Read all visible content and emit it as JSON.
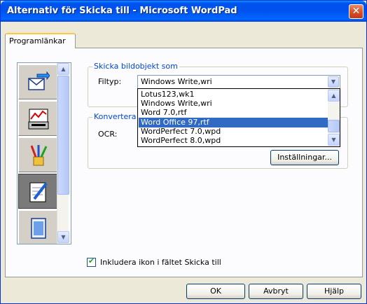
{
  "window": {
    "title": "Alternativ för Skicka till - Microsoft WordPad",
    "close_glyph": "✕"
  },
  "tabs": [
    {
      "label": "Programlänkar"
    }
  ],
  "icon_list": {
    "items": [
      {
        "icon": "envelope-arrow-icon",
        "selected": false
      },
      {
        "icon": "graph-printer-icon",
        "selected": false
      },
      {
        "icon": "paint-brushes-icon",
        "selected": false
      },
      {
        "icon": "notepad-pen-icon",
        "selected": true
      },
      {
        "icon": "document-icon",
        "selected": false
      }
    ],
    "scroll_up_glyph": "▲",
    "scroll_down_glyph": "▼"
  },
  "send_group": {
    "label": "Skicka bildobjekt som",
    "filetype_label": "Filtyp:",
    "selected_value": "Windows Write,wri",
    "dropdown_options": [
      {
        "label": "Lotus123,wk1",
        "selected": false
      },
      {
        "label": "Windows Write,wri",
        "selected": false
      },
      {
        "label": "Word 7.0,rtf",
        "selected": false
      },
      {
        "label": "Word Office 97,rtf",
        "selected": true
      },
      {
        "label": "WordPerfect 7.0,wpd",
        "selected": false
      },
      {
        "label": "WordPerfect 8.0,wpd",
        "selected": false
      }
    ]
  },
  "convert_group": {
    "label": "Konvertera b",
    "ocr_label": "OCR:",
    "settings_button": "Inställningar..."
  },
  "include_checkbox": {
    "label": "Inkludera ikon i fältet Skicka till",
    "checked": true,
    "check_glyph": "✔"
  },
  "buttons": {
    "ok": "OK",
    "cancel": "Avbryt",
    "help": "Hjälp"
  },
  "colors": {
    "titlebar": "#0054e3",
    "selection": "#316ac5",
    "group_label": "#0046d5",
    "dialog_bg": "#ece9d8"
  }
}
